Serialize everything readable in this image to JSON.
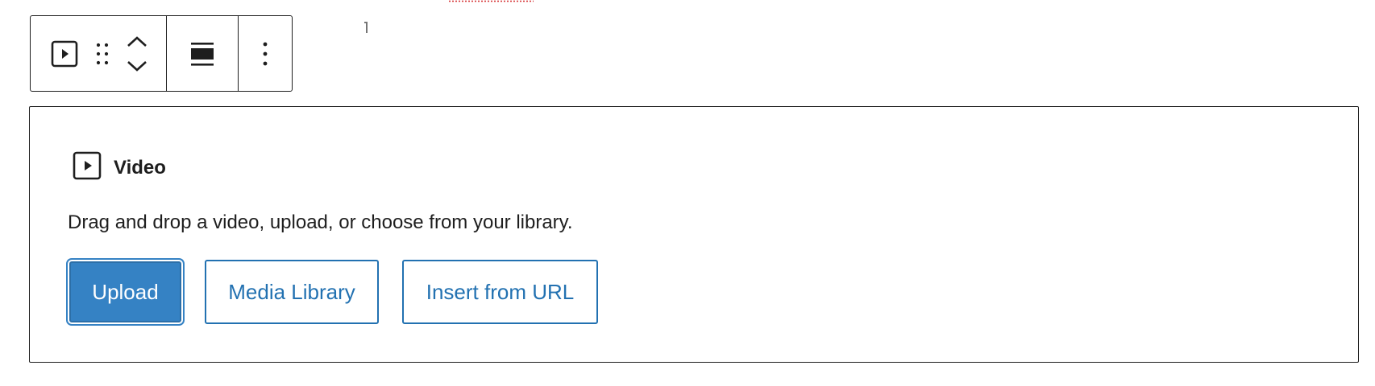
{
  "toolbar": {
    "block_type_icon": "video-play-icon",
    "drag_icon": "drag-handle-icon",
    "move_up_icon": "chevron-up-icon",
    "move_down_icon": "chevron-down-icon",
    "align_icon": "align-wide-icon",
    "options_icon": "more-vertical-icon"
  },
  "placeholder": {
    "icon": "video-play-icon",
    "label": "Video",
    "instructions": "Drag and drop a video, upload, or choose from your library.",
    "buttons": {
      "upload": "Upload",
      "media_library": "Media Library",
      "insert_url": "Insert from URL"
    }
  },
  "colors": {
    "accent": "#3582c4",
    "link": "#2271b1",
    "text": "#1e1e1e",
    "border": "#1e1e1e"
  }
}
